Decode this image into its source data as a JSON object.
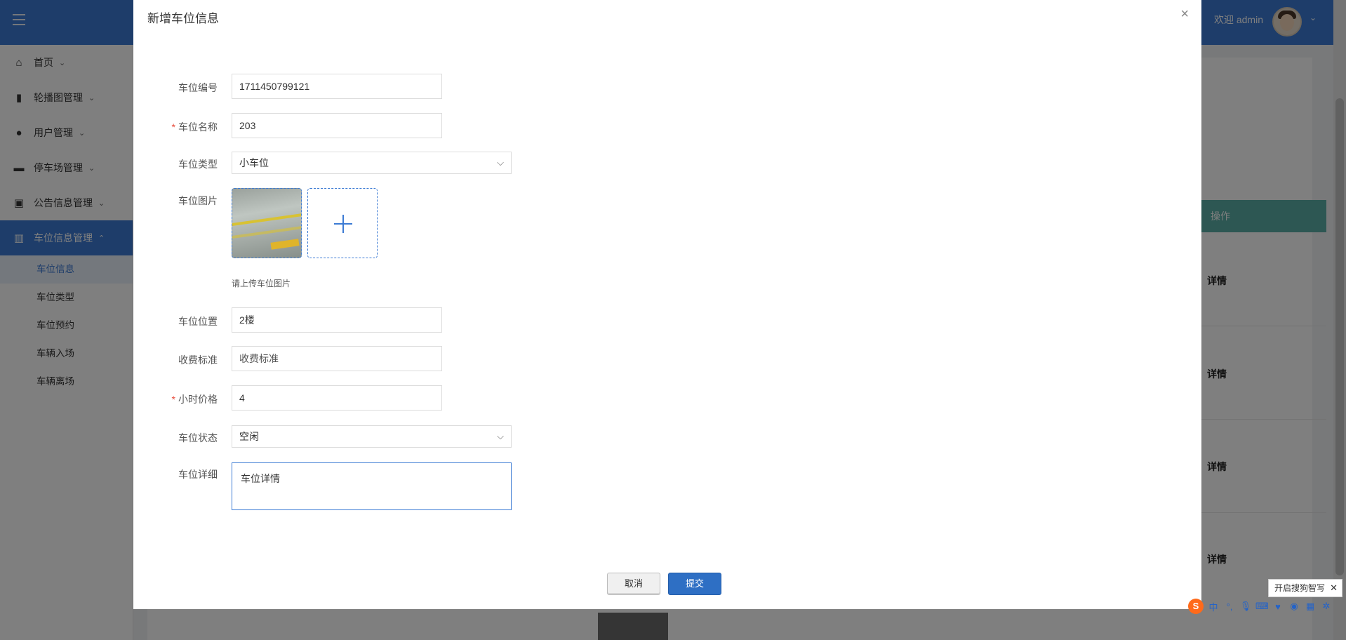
{
  "app": {
    "welcome": "欢迎 admin",
    "avatar_caret": "⌄"
  },
  "sidebar": {
    "items": [
      {
        "label": "首页",
        "icon": "home-icon"
      },
      {
        "label": "轮播图管理",
        "icon": "carousel-icon"
      },
      {
        "label": "用户管理",
        "icon": "user-icon"
      },
      {
        "label": "停车场管理",
        "icon": "car-icon"
      },
      {
        "label": "公告信息管理",
        "icon": "gift-icon"
      },
      {
        "label": "车位信息管理",
        "icon": "parking-icon"
      }
    ],
    "subitems": [
      "车位信息",
      "车位类型",
      "车位预约",
      "车辆入场",
      "车辆离场"
    ]
  },
  "table": {
    "op_header": "操作",
    "detail_label": "详情"
  },
  "dialog": {
    "title": "新增车位信息",
    "close": "×",
    "fields": {
      "code": {
        "label": "车位编号",
        "value": "1711450799121"
      },
      "name": {
        "label": "车位名称",
        "value": "203",
        "required": "*"
      },
      "type": {
        "label": "车位类型",
        "value": "小车位"
      },
      "image": {
        "label": "车位图片",
        "hint": "请上传车位图片"
      },
      "location": {
        "label": "车位位置",
        "value": "2楼"
      },
      "fee": {
        "label": "收费标准",
        "placeholder": "收费标准"
      },
      "price": {
        "label": "小时价格",
        "value": "4",
        "required": "*"
      },
      "status": {
        "label": "车位状态",
        "value": "空闲"
      },
      "detail": {
        "label": "车位详细",
        "value": "车位详情"
      }
    },
    "buttons": {
      "cancel": "取消",
      "submit": "提交"
    }
  },
  "ime": {
    "tip": "开启搜狗智写",
    "tip_close": "✕",
    "logo": "S",
    "lang": "中"
  },
  "colors": {
    "primary": "#3c7bd4",
    "header": "#5aaea6",
    "required": "#e74c3c"
  }
}
